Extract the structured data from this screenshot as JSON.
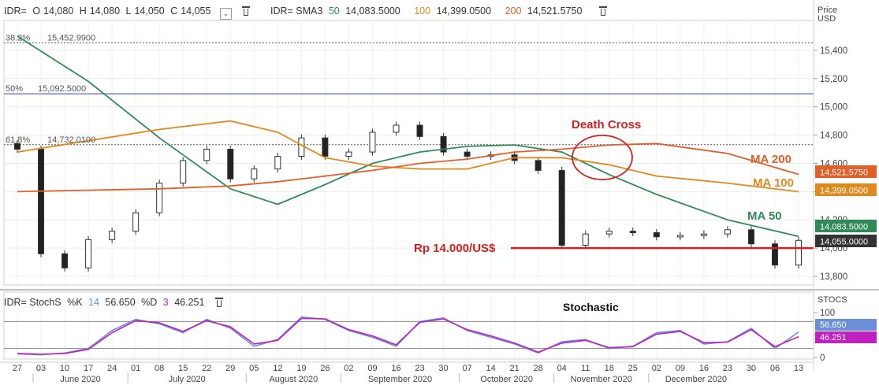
{
  "header": {
    "symbol": "IDR=",
    "open_label": "O",
    "open": "14,080",
    "high_label": "H",
    "high": "14,080",
    "low_label": "L",
    "low": "14,050",
    "close_label": "C",
    "close": "14,055",
    "sma_label": "IDR= SMA3",
    "sma50_period": "50",
    "sma50_value": "14,083.5000",
    "sma100_period": "100",
    "sma100_value": "14,399.0500",
    "sma200_period": "200",
    "sma200_value": "14,521.5750"
  },
  "stoch_header": {
    "label": "IDR= StochS",
    "k_label": "%K",
    "k_period": "14",
    "k_value": "56.650",
    "d_label": "%D",
    "d_period": "3",
    "d_value": "46.251"
  },
  "colors": {
    "sma50": "#2e8b57",
    "sma100": "#e08a1e",
    "sma200": "#e0602a",
    "fib": "#555555",
    "fib50": "#3344aa",
    "support": "#d62020",
    "annotation": "#d62020",
    "stochK": "#6b8fd6",
    "stochD": "#c020c0"
  },
  "chart_data": [
    {
      "type": "candlestick",
      "title": "",
      "ylabel": "Price USD",
      "y_label_line1": "Price",
      "y_label_line2": "USD",
      "ylim": [
        13750,
        15600
      ],
      "yticks": [
        13800,
        14000,
        14200,
        14400,
        14600,
        14800,
        15000,
        15200,
        15400
      ],
      "ytick_labels": [
        "13,800",
        "14,000",
        "14,200",
        "14,400",
        "14,600",
        "14,800",
        "15,000",
        "15,200",
        "15,400"
      ],
      "grid": true,
      "x_day_labels": [
        "27",
        "03",
        "10",
        "17",
        "24",
        "01",
        "08",
        "15",
        "22",
        "29",
        "05",
        "12",
        "19",
        "26",
        "02",
        "09",
        "16",
        "23",
        "30",
        "07",
        "14",
        "21",
        "28",
        "04",
        "11",
        "18",
        "25",
        "02",
        "09",
        "16",
        "23",
        "30",
        "06",
        "13"
      ],
      "x_month_labels": [
        "June 2020",
        "July 2020",
        "August 2020",
        "September 2020",
        "October 2020",
        "November 2020",
        "December 2020"
      ],
      "fib_levels": [
        {
          "label": "38.2%",
          "value_label": "15,452.9900",
          "value": 15452.99
        },
        {
          "label": "50%",
          "value_label": "15,092.5000",
          "value": 15092.5
        },
        {
          "label": "61.8%",
          "value_label": "14,732.0100",
          "value": 14732.01
        }
      ],
      "support": {
        "value": 14000,
        "label": "Rp 14.000/US$"
      },
      "annotations": {
        "death_cross": "Death Cross",
        "ma50": "MA 50",
        "ma100": "MA 100",
        "ma200": "MA 200"
      },
      "last_value_tags": [
        {
          "text": "14,521.5750",
          "value": 14521.575,
          "color": "#e0602a"
        },
        {
          "text": "14,399.0500",
          "value": 14399.05,
          "color": "#e08a1e"
        },
        {
          "text": "14,083.5000",
          "value": 14083.5,
          "color": "#2e8b57"
        },
        {
          "text": "14,055.0000",
          "value": 14055,
          "color": "#333333"
        }
      ],
      "weekly_close": [
        14700,
        13960,
        13860,
        14060,
        14120,
        14250,
        14460,
        14620,
        14700,
        14490,
        14560,
        14650,
        14780,
        14650,
        14680,
        14820,
        14870,
        14790,
        14680,
        14650,
        14660,
        14620,
        14550,
        14020,
        14100,
        14120,
        14110,
        14080,
        14090,
        14100,
        14130,
        14030,
        13880,
        14055
      ],
      "series": [
        {
          "name": "MA 50",
          "x_idx": [
            0,
            3,
            6,
            9,
            11,
            13,
            15,
            17,
            19,
            21,
            23,
            25,
            27,
            30,
            33
          ],
          "values": [
            15500,
            15180,
            14780,
            14420,
            14310,
            14450,
            14600,
            14680,
            14720,
            14730,
            14680,
            14520,
            14380,
            14200,
            14083.5
          ]
        },
        {
          "name": "MA 100",
          "x_idx": [
            0,
            3,
            6,
            9,
            11,
            13,
            15,
            17,
            19,
            21,
            23,
            25,
            27,
            30,
            33
          ],
          "values": [
            14680,
            14760,
            14840,
            14900,
            14820,
            14640,
            14580,
            14560,
            14560,
            14640,
            14640,
            14590,
            14510,
            14460,
            14399.05
          ]
        },
        {
          "name": "MA 200",
          "x_idx": [
            0,
            3,
            6,
            9,
            11,
            13,
            15,
            17,
            19,
            21,
            23,
            25,
            27,
            30,
            33
          ],
          "values": [
            14400,
            14410,
            14420,
            14440,
            14470,
            14510,
            14550,
            14600,
            14630,
            14680,
            14700,
            14730,
            14740,
            14670,
            14521.575
          ]
        }
      ]
    },
    {
      "type": "line",
      "title": "Stochastic",
      "ylabel": "STOCS",
      "ylim": [
        0,
        100
      ],
      "yticks": [
        0,
        50,
        100
      ],
      "ytick_labels": [
        "0",
        "50",
        "100"
      ],
      "levels": [
        20,
        80
      ],
      "series": [
        {
          "name": "%K",
          "values": [
            8,
            6,
            10,
            20,
            60,
            85,
            75,
            55,
            85,
            65,
            25,
            40,
            90,
            85,
            60,
            45,
            25,
            80,
            88,
            60,
            45,
            30,
            10,
            35,
            40,
            20,
            25,
            55,
            60,
            30,
            35,
            65,
            20,
            56.65
          ]
        },
        {
          "name": "%D",
          "values": [
            9,
            7,
            9,
            18,
            55,
            82,
            77,
            58,
            82,
            68,
            30,
            38,
            87,
            86,
            62,
            48,
            28,
            78,
            86,
            62,
            48,
            32,
            12,
            32,
            38,
            22,
            24,
            52,
            58,
            33,
            34,
            62,
            24,
            46.251
          ]
        }
      ]
    }
  ]
}
